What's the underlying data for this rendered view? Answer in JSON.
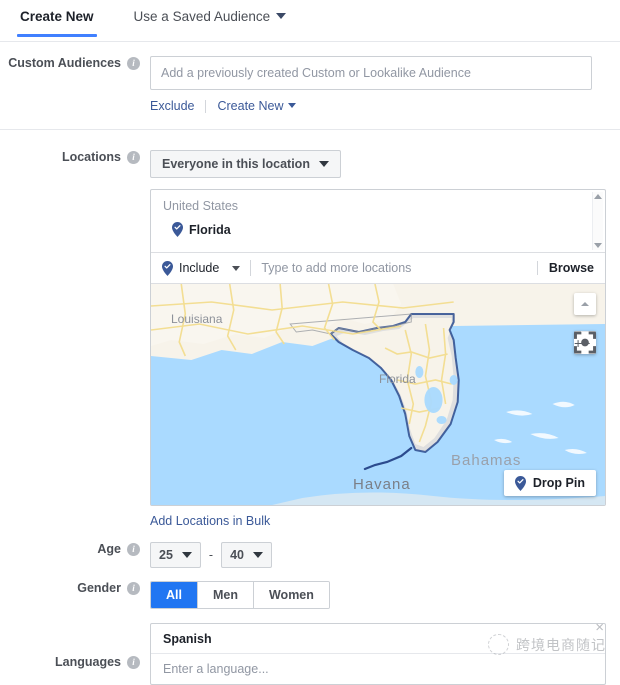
{
  "tabs": [
    {
      "label": "Create New",
      "active": true,
      "caret": false
    },
    {
      "label": "Use a Saved Audience",
      "active": false,
      "caret": true
    }
  ],
  "custom_audiences": {
    "label": "Custom Audiences",
    "placeholder": "Add a previously created Custom or Lookalike Audience",
    "value": "",
    "exclude_link": "Exclude",
    "create_new_link": "Create New"
  },
  "locations": {
    "label": "Locations",
    "scope_selector": "Everyone in this location",
    "group_header": "United States",
    "selected": [
      {
        "name": "Florida",
        "icon": "location-pin-check-icon"
      }
    ],
    "include_label": "Include",
    "input_placeholder": "Type to add more locations",
    "browse_label": "Browse",
    "bulk_link": "Add Locations in Bulk",
    "map": {
      "labels": [
        "Louisiana",
        "Florida",
        "Bahamas",
        "Havana"
      ],
      "marker": "location-pin-check-icon",
      "drop_pin_label": "Drop Pin",
      "zoom_in": "+",
      "zoom_out": "−",
      "water_color": "#aadaff",
      "land_color": "#f7f3ea",
      "highlight_color": "#dcdcdc",
      "road_color": "#f3dd8f",
      "pin_color": "#2c4b8e"
    }
  },
  "age": {
    "label": "Age",
    "min": "25",
    "max": "40",
    "separator": "-"
  },
  "gender": {
    "label": "Gender",
    "options": [
      "All",
      "Men",
      "Women"
    ],
    "selected": "All",
    "accent_color": "#2176f2"
  },
  "languages": {
    "label": "Languages",
    "selected": "Spanish",
    "placeholder": "Enter a language..."
  },
  "watermark": {
    "text": "跨境电商随记",
    "close": "×"
  }
}
